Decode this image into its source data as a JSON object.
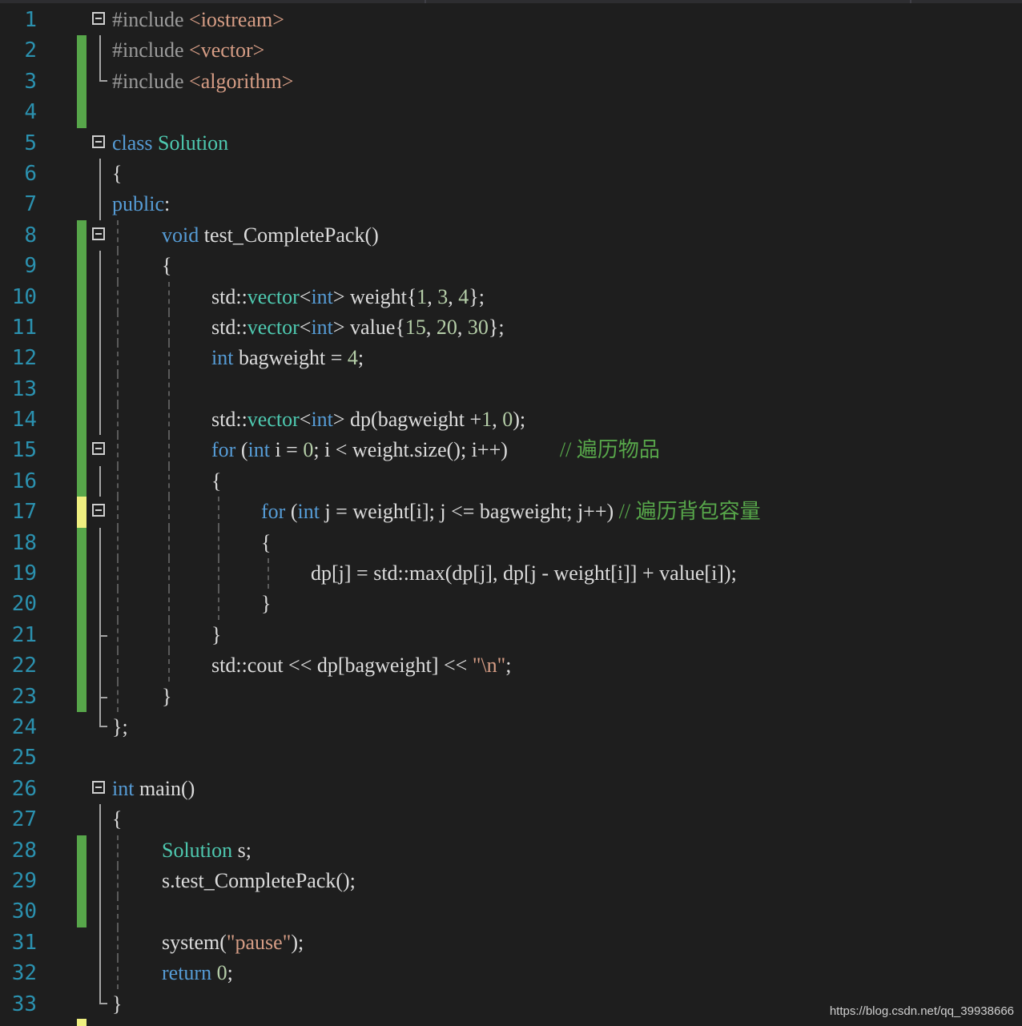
{
  "editor": {
    "lines": [
      {
        "n": "1",
        "change": "none",
        "fold": "box",
        "guides": [],
        "indent": 0,
        "tokens": [
          [
            "pp",
            "#include "
          ],
          [
            "str",
            "<iostream>"
          ]
        ]
      },
      {
        "n": "2",
        "change": "saved",
        "fold": "vline",
        "guides": [],
        "indent": 0,
        "tokens": [
          [
            "pp",
            "#include "
          ],
          [
            "str",
            "<vector>"
          ]
        ]
      },
      {
        "n": "3",
        "change": "saved",
        "fold": "end",
        "guides": [],
        "indent": 0,
        "tokens": [
          [
            "pp",
            "#include "
          ],
          [
            "str",
            "<algorithm>"
          ]
        ]
      },
      {
        "n": "4",
        "change": "saved",
        "fold": "none",
        "guides": [],
        "indent": 0,
        "tokens": []
      },
      {
        "n": "5",
        "change": "none",
        "fold": "box",
        "guides": [],
        "indent": 0,
        "tokens": [
          [
            "kw",
            "class "
          ],
          [
            "ty",
            "Solution"
          ]
        ]
      },
      {
        "n": "6",
        "change": "none",
        "fold": "vline",
        "guides": [],
        "indent": 0,
        "tokens": [
          [
            "tx",
            "{"
          ]
        ]
      },
      {
        "n": "7",
        "change": "none",
        "fold": "vline",
        "guides": [],
        "indent": 0,
        "tokens": [
          [
            "kw",
            "public"
          ],
          [
            "tx",
            ":"
          ]
        ]
      },
      {
        "n": "8",
        "change": "saved",
        "fold": "box",
        "guides": [
          146
        ],
        "indent": 1,
        "tokens": [
          [
            "kw",
            "void "
          ],
          [
            "tx",
            "test_CompletePack()"
          ]
        ]
      },
      {
        "n": "9",
        "change": "saved",
        "fold": "vline",
        "guides": [
          146
        ],
        "indent": 1,
        "tokens": [
          [
            "tx",
            "{"
          ]
        ]
      },
      {
        "n": "10",
        "change": "saved",
        "fold": "vline",
        "guides": [
          146,
          210
        ],
        "indent": 2,
        "tokens": [
          [
            "tx",
            "std::"
          ],
          [
            "ty",
            "vector"
          ],
          [
            "tx",
            "<"
          ],
          [
            "kw",
            "int"
          ],
          [
            "tx",
            "> weight{"
          ],
          [
            "num",
            "1"
          ],
          [
            "tx",
            ", "
          ],
          [
            "num",
            "3"
          ],
          [
            "tx",
            ", "
          ],
          [
            "num",
            "4"
          ],
          [
            "tx",
            "};"
          ]
        ]
      },
      {
        "n": "11",
        "change": "saved",
        "fold": "vline",
        "guides": [
          146,
          210
        ],
        "indent": 2,
        "tokens": [
          [
            "tx",
            "std::"
          ],
          [
            "ty",
            "vector"
          ],
          [
            "tx",
            "<"
          ],
          [
            "kw",
            "int"
          ],
          [
            "tx",
            "> value{"
          ],
          [
            "num",
            "15"
          ],
          [
            "tx",
            ", "
          ],
          [
            "num",
            "20"
          ],
          [
            "tx",
            ", "
          ],
          [
            "num",
            "30"
          ],
          [
            "tx",
            "};"
          ]
        ]
      },
      {
        "n": "12",
        "change": "saved",
        "fold": "vline",
        "guides": [
          146,
          210
        ],
        "indent": 2,
        "tokens": [
          [
            "kw",
            "int "
          ],
          [
            "tx",
            "bagweight = "
          ],
          [
            "num",
            "4"
          ],
          [
            "tx",
            ";"
          ]
        ]
      },
      {
        "n": "13",
        "change": "saved",
        "fold": "vline",
        "guides": [
          146,
          210
        ],
        "indent": 2,
        "tokens": []
      },
      {
        "n": "14",
        "change": "saved",
        "fold": "vline",
        "guides": [
          146,
          210
        ],
        "indent": 2,
        "tokens": [
          [
            "tx",
            "std::"
          ],
          [
            "ty",
            "vector"
          ],
          [
            "tx",
            "<"
          ],
          [
            "kw",
            "int"
          ],
          [
            "tx",
            "> dp(bagweight +"
          ],
          [
            "num",
            "1"
          ],
          [
            "tx",
            ", "
          ],
          [
            "num",
            "0"
          ],
          [
            "tx",
            ");"
          ]
        ]
      },
      {
        "n": "15",
        "change": "saved",
        "fold": "box",
        "guides": [
          146,
          210
        ],
        "indent": 2,
        "tokens": [
          [
            "kw",
            "for "
          ],
          [
            "tx",
            "("
          ],
          [
            "kw",
            "int "
          ],
          [
            "tx",
            "i = "
          ],
          [
            "num",
            "0"
          ],
          [
            "tx",
            "; i < weight.size(); i++)          "
          ],
          [
            "cm",
            "// 遍历物品"
          ]
        ]
      },
      {
        "n": "16",
        "change": "saved",
        "fold": "vline",
        "guides": [
          146,
          210
        ],
        "indent": 2,
        "tokens": [
          [
            "tx",
            "{"
          ]
        ]
      },
      {
        "n": "17",
        "change": "unsaved",
        "fold": "box",
        "guides": [
          146,
          210,
          272
        ],
        "indent": 3,
        "tokens": [
          [
            "kw",
            "for "
          ],
          [
            "tx",
            "("
          ],
          [
            "kw",
            "int "
          ],
          [
            "tx",
            "j = weight[i]; j <= bagweight; j++) "
          ],
          [
            "cm",
            "// 遍历背包容量"
          ]
        ]
      },
      {
        "n": "18",
        "change": "saved",
        "fold": "vline",
        "guides": [
          146,
          210,
          272
        ],
        "indent": 3,
        "tokens": [
          [
            "tx",
            "{"
          ]
        ]
      },
      {
        "n": "19",
        "change": "saved",
        "fold": "vline",
        "guides": [
          146,
          210,
          272,
          334
        ],
        "indent": 4,
        "tokens": [
          [
            "tx",
            "dp[j] = std::max(dp[j], dp[j - weight[i]] + value[i]);"
          ]
        ]
      },
      {
        "n": "20",
        "change": "saved",
        "fold": "vline",
        "guides": [
          146,
          210,
          272
        ],
        "indent": 3,
        "tokens": [
          [
            "tx",
            "}"
          ]
        ]
      },
      {
        "n": "21",
        "change": "saved",
        "fold": "sub",
        "guides": [
          146,
          210
        ],
        "indent": 2,
        "tokens": [
          [
            "tx",
            "}"
          ]
        ]
      },
      {
        "n": "22",
        "change": "saved",
        "fold": "vline",
        "guides": [
          146,
          210
        ],
        "indent": 2,
        "tokens": [
          [
            "tx",
            "std::cout << dp[bagweight] << "
          ],
          [
            "str",
            "\"\\n\""
          ],
          [
            "tx",
            ";"
          ]
        ]
      },
      {
        "n": "23",
        "change": "saved",
        "fold": "sub",
        "guides": [
          146
        ],
        "indent": 1,
        "tokens": [
          [
            "tx",
            "}"
          ]
        ]
      },
      {
        "n": "24",
        "change": "none",
        "fold": "end",
        "guides": [],
        "indent": 0,
        "tokens": [
          [
            "tx",
            "};"
          ]
        ]
      },
      {
        "n": "25",
        "change": "none",
        "fold": "none",
        "guides": [],
        "indent": 0,
        "tokens": []
      },
      {
        "n": "26",
        "change": "none",
        "fold": "box",
        "guides": [],
        "indent": 0,
        "tokens": [
          [
            "kw",
            "int "
          ],
          [
            "tx",
            "main()"
          ]
        ]
      },
      {
        "n": "27",
        "change": "none",
        "fold": "vline",
        "guides": [],
        "indent": 0,
        "tokens": [
          [
            "tx",
            "{"
          ]
        ]
      },
      {
        "n": "28",
        "change": "saved",
        "fold": "vline",
        "guides": [
          146
        ],
        "indent": 1,
        "tokens": [
          [
            "ty",
            "Solution "
          ],
          [
            "tx",
            "s;"
          ]
        ]
      },
      {
        "n": "29",
        "change": "saved",
        "fold": "vline",
        "guides": [
          146
        ],
        "indent": 1,
        "tokens": [
          [
            "tx",
            "s.test_CompletePack();"
          ]
        ]
      },
      {
        "n": "30",
        "change": "saved",
        "fold": "vline",
        "guides": [
          146
        ],
        "indent": 1,
        "tokens": []
      },
      {
        "n": "31",
        "change": "none",
        "fold": "vline",
        "guides": [
          146
        ],
        "indent": 1,
        "tokens": [
          [
            "tx",
            "system("
          ],
          [
            "str",
            "\"pause\""
          ],
          [
            "tx",
            ");"
          ]
        ]
      },
      {
        "n": "32",
        "change": "none",
        "fold": "vline",
        "guides": [
          146
        ],
        "indent": 1,
        "tokens": [
          [
            "kw",
            "return "
          ],
          [
            "num",
            "0"
          ],
          [
            "tx",
            ";"
          ]
        ]
      },
      {
        "n": "33",
        "change": "none",
        "fold": "end",
        "guides": [],
        "indent": 0,
        "tokens": [
          [
            "tx",
            "}"
          ]
        ]
      }
    ]
  },
  "watermark": "https://blog.csdn.net/qq_39938666",
  "colors": {
    "background": "#1e1e1e",
    "line_number": "#2b91af",
    "keyword": "#569cd6",
    "type": "#4ec9b0",
    "string": "#d69d85",
    "number": "#b5cea8",
    "comment": "#57a64a",
    "saved_change": "#57a64a",
    "unsaved_change": "#efef80"
  },
  "icons": {
    "fold": "collapse-box-icon"
  }
}
